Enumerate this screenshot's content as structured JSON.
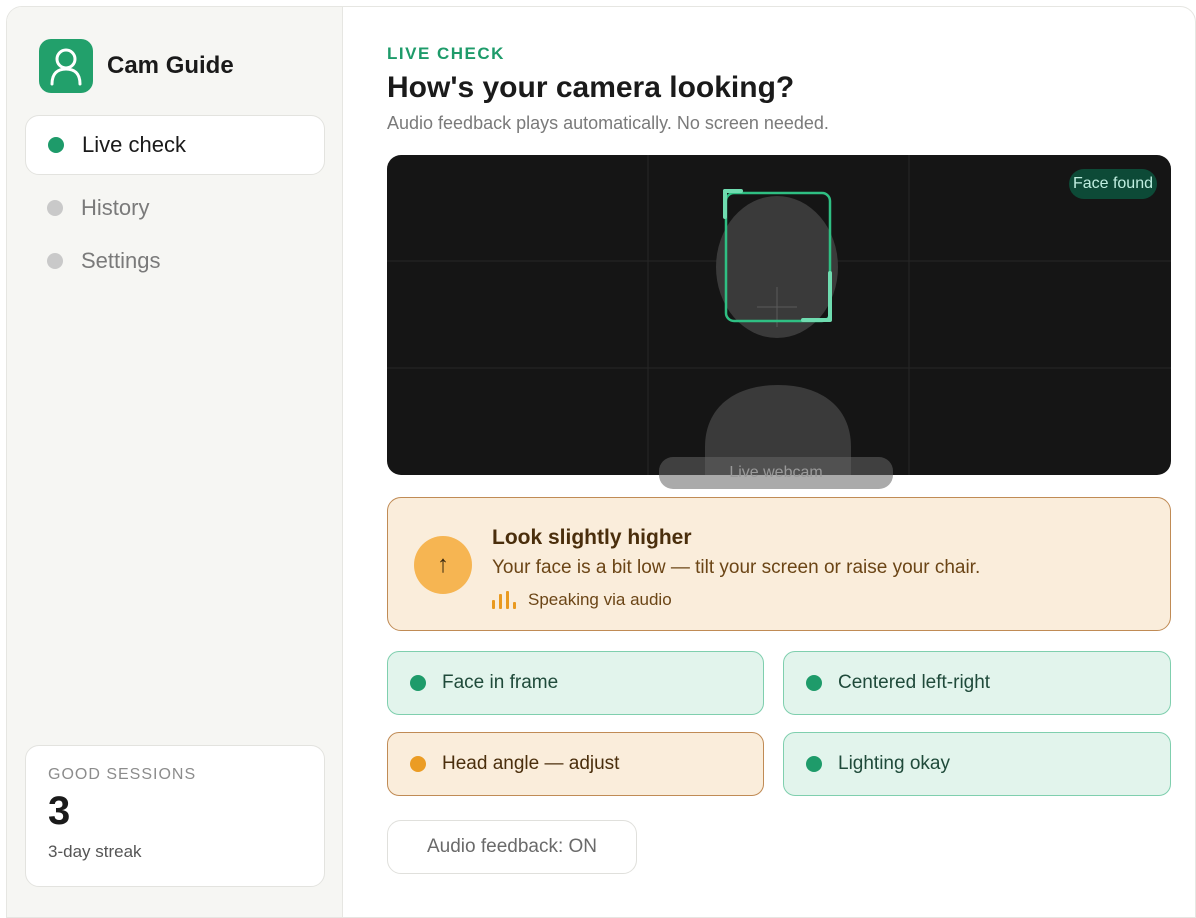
{
  "app": {
    "name": "Cam Guide"
  },
  "sidebar": {
    "items": [
      {
        "label": "Live check",
        "active": true
      },
      {
        "label": "History",
        "active": false
      },
      {
        "label": "Settings",
        "active": false
      }
    ],
    "sessions": {
      "label": "GOOD SESSIONS",
      "count": "3",
      "streak": "3-day streak"
    }
  },
  "main": {
    "eyebrow": "LIVE CHECK",
    "title": "How's your camera looking?",
    "subtitle": "Audio feedback plays automatically. No screen needed."
  },
  "camera": {
    "badge": "Face found",
    "caption": "Live webcam",
    "colors": {
      "frame": "#2fbf83",
      "badge_bg": "#0d4a37"
    }
  },
  "alert": {
    "icon": "arrow-up-icon",
    "title": "Look slightly higher",
    "body": "Your face is a bit low — tilt your screen or raise your chair.",
    "audio_label": "Speaking via audio"
  },
  "checks": [
    {
      "label": "Face in frame",
      "status": "ok"
    },
    {
      "label": "Centered left-right",
      "status": "ok"
    },
    {
      "label": "Head angle — adjust",
      "status": "warn"
    },
    {
      "label": "Lighting okay",
      "status": "ok"
    }
  ],
  "audio_toggle": {
    "label": "Audio feedback: ON"
  },
  "colors": {
    "accent": "#1e9b6a",
    "warning": "#eb9c24"
  }
}
